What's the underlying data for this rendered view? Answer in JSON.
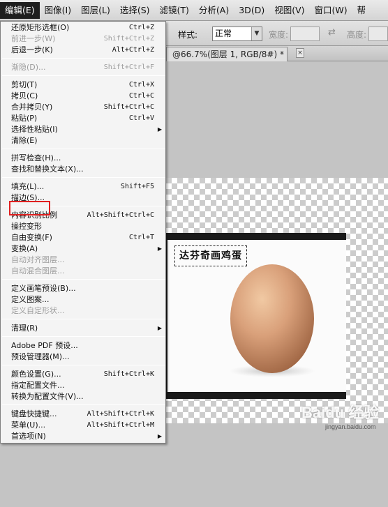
{
  "menubar": {
    "items": [
      "编辑(E)",
      "图像(I)",
      "图层(L)",
      "选择(S)",
      "滤镜(T)",
      "分析(A)",
      "3D(D)",
      "视图(V)",
      "窗口(W)",
      "帮"
    ]
  },
  "options_bar": {
    "style_label": "样式:",
    "style_value": "正常",
    "width_label": "宽度:",
    "height_label": "高度:",
    "swap_icon": "⇄"
  },
  "document_tab": {
    "title": "@66.7%(图层 1, RGB/8#) *",
    "close": "×"
  },
  "edit_menu": {
    "g1": [
      {
        "label": "还原矩形选框(O)",
        "shortcut": "Ctrl+Z"
      },
      {
        "label": "前进一步(W)",
        "shortcut": "Shift+Ctrl+Z"
      },
      {
        "label": "后退一步(K)",
        "shortcut": "Alt+Ctrl+Z"
      }
    ],
    "g2": [
      {
        "label": "渐隐(D)...",
        "shortcut": "Shift+Ctrl+F"
      }
    ],
    "g3": [
      {
        "label": "剪切(T)",
        "shortcut": "Ctrl+X"
      },
      {
        "label": "拷贝(C)",
        "shortcut": "Ctrl+C"
      },
      {
        "label": "合并拷贝(Y)",
        "shortcut": "Shift+Ctrl+C"
      },
      {
        "label": "粘贴(P)",
        "shortcut": "Ctrl+V"
      },
      {
        "label": "选择性粘贴(I)",
        "shortcut": ""
      },
      {
        "label": "清除(E)",
        "shortcut": ""
      }
    ],
    "g4": [
      {
        "label": "拼写检查(H)...",
        "shortcut": ""
      },
      {
        "label": "查找和替换文本(X)...",
        "shortcut": ""
      }
    ],
    "g5": [
      {
        "label": "填充(L)...",
        "shortcut": "Shift+F5"
      },
      {
        "label": "描边(S)...",
        "shortcut": ""
      }
    ],
    "g6": [
      {
        "label": "内容识别比例",
        "shortcut": "Alt+Shift+Ctrl+C"
      },
      {
        "label": "操控变形",
        "shortcut": ""
      },
      {
        "label": "自由变换(F)",
        "shortcut": "Ctrl+T"
      },
      {
        "label": "变换(A)",
        "shortcut": ""
      },
      {
        "label": "自动对齐图层...",
        "shortcut": ""
      },
      {
        "label": "自动混合图层...",
        "shortcut": ""
      }
    ],
    "g7": [
      {
        "label": "定义画笔预设(B)...",
        "shortcut": ""
      },
      {
        "label": "定义图案...",
        "shortcut": ""
      },
      {
        "label": "定义自定形状...",
        "shortcut": ""
      }
    ],
    "g8": [
      {
        "label": "清理(R)",
        "shortcut": ""
      }
    ],
    "g9": [
      {
        "label": "Adobe PDF 预设...",
        "shortcut": ""
      },
      {
        "label": "预设管理器(M)...",
        "shortcut": ""
      }
    ],
    "g10": [
      {
        "label": "颜色设置(G)...",
        "shortcut": "Shift+Ctrl+K"
      },
      {
        "label": "指定配置文件...",
        "shortcut": ""
      },
      {
        "label": "转换为配置文件(V)...",
        "shortcut": ""
      }
    ],
    "g11": [
      {
        "label": "键盘快捷键...",
        "shortcut": "Alt+Shift+Ctrl+K"
      },
      {
        "label": "菜单(U)...",
        "shortcut": "Alt+Shift+Ctrl+M"
      },
      {
        "label": "首选项(N)",
        "shortcut": ""
      }
    ],
    "submenu_arrow": "▶"
  },
  "canvas": {
    "image_title": "达芬奇画鸡蛋",
    "watermark": "Baidu 经验",
    "watermark_url": "jingyan.baidu.com"
  }
}
